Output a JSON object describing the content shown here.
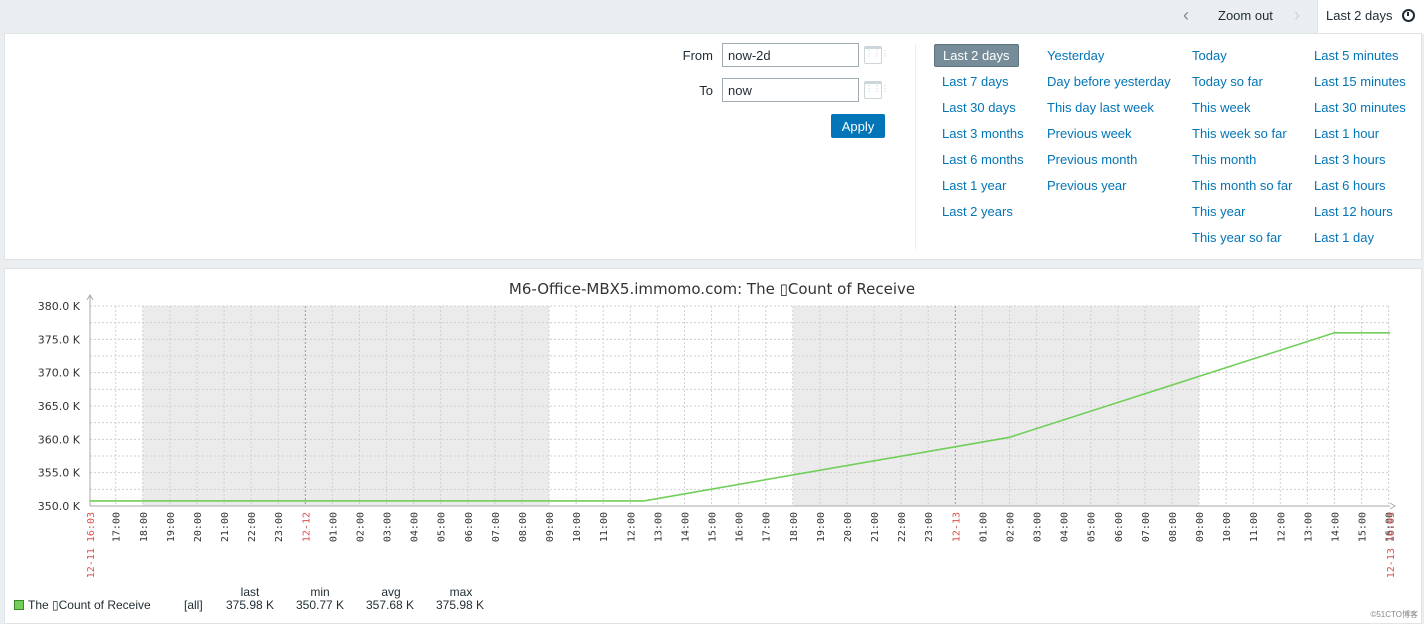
{
  "topbar": {
    "prev_icon": "chevron-left-icon",
    "zoom_out": "Zoom out",
    "next_icon": "chevron-right-icon",
    "active_period": "Last 2 days",
    "clock_icon": "clock-icon"
  },
  "filter": {
    "from_label": "From",
    "from_value": "now-2d",
    "to_label": "To",
    "to_value": "now",
    "calendar_icon": "calendar-icon",
    "apply": "Apply",
    "quick": [
      [
        "Last 2 days",
        "Last 7 days",
        "Last 30 days",
        "Last 3 months",
        "Last 6 months",
        "Last 1 year",
        "Last 2 years"
      ],
      [
        "Yesterday",
        "Day before yesterday",
        "This day last week",
        "Previous week",
        "Previous month",
        "Previous year"
      ],
      [
        "Today",
        "Today so far",
        "This week",
        "This week so far",
        "This month",
        "This month so far",
        "This year",
        "This year so far"
      ],
      [
        "Last 5 minutes",
        "Last 15 minutes",
        "Last 30 minutes",
        "Last 1 hour",
        "Last 3 hours",
        "Last 6 hours",
        "Last 12 hours",
        "Last 1 day"
      ]
    ],
    "selected": "Last 2 days"
  },
  "colors": {
    "accent": "#0275b8",
    "series": "#6fcf59",
    "shade": "#ebebeb",
    "date_label": "#d9534f"
  },
  "chart_data": {
    "type": "line",
    "title": "M6-Office-MBX5.immomo.com: The ▯Count of Receive",
    "x_range": [
      "12-11 16:03",
      "12-13 16:03"
    ],
    "x_start_label": "12-11 16:03",
    "x_end_label": "12-13 16:03",
    "ylim": [
      350,
      380
    ],
    "y_unit": "K",
    "y_ticks": [
      "350.0 K",
      "355.0 K",
      "360.0 K",
      "365.0 K",
      "370.0 K",
      "375.0 K",
      "380.0 K"
    ],
    "grid": true,
    "shaded_periods": [
      [
        "12-11 18:00",
        "12-12 09:00"
      ],
      [
        "12-12 18:00",
        "12-13 09:00"
      ]
    ],
    "series": [
      {
        "name": "The ▯Count of Receive",
        "points": [
          [
            "12-11 16:03",
            350.77
          ],
          [
            "12-12 12:30",
            350.77
          ],
          [
            "12-13 02:00",
            360.3
          ],
          [
            "12-13 14:00",
            375.98
          ],
          [
            "12-13 16:03",
            375.98
          ]
        ]
      }
    ],
    "legend": {
      "placement": "bottom-left",
      "function": "[all]",
      "headers": [
        "last",
        "min",
        "avg",
        "max"
      ],
      "values": [
        "375.98 K",
        "350.77 K",
        "357.68 K",
        "375.98 K"
      ]
    }
  },
  "watermark": "©51CTO博客"
}
